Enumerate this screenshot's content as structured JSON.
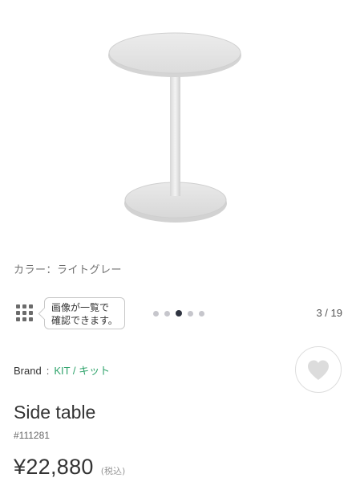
{
  "product_image": {
    "name": "side-table-photo"
  },
  "color_caption": "カラー：ライトグレー",
  "gallery": {
    "tooltip_lines": [
      "画像が一覧で",
      "確認できます。"
    ],
    "dots_total": 5,
    "active_dot": 2,
    "counter": "3 / 19"
  },
  "brand": {
    "label": "Brand",
    "separator": ":",
    "name": "KIT / キット",
    "link_color": "#2fa36b"
  },
  "favorite": {
    "icon": "heart-icon"
  },
  "product": {
    "title": "Side table",
    "code": "#111281",
    "price": "¥22,880",
    "tax_note": "(税込)"
  }
}
